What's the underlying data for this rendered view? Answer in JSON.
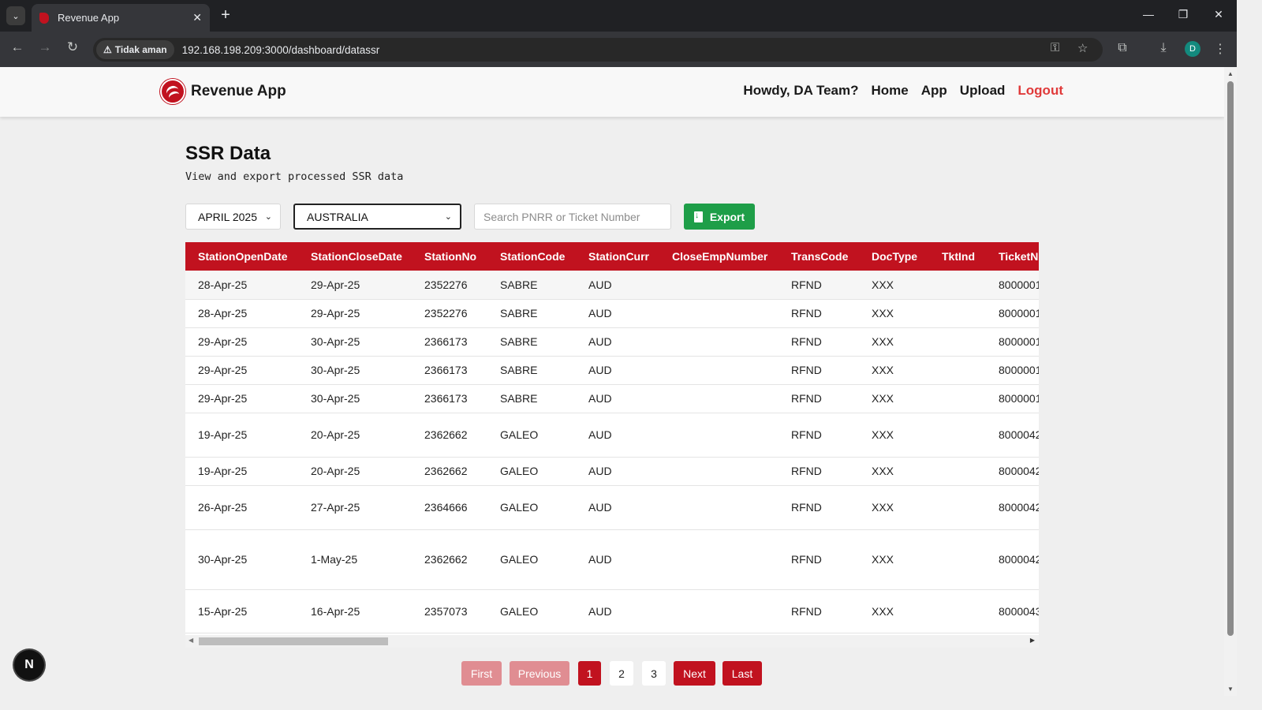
{
  "browser": {
    "tab_title": "Revenue App",
    "security_label": "Tidak aman",
    "url": "192.168.198.209:3000/dashboard/datassr",
    "profile_initial": "D"
  },
  "nav": {
    "brand": "Revenue App",
    "greeting": "Howdy, DA Team?",
    "links": [
      "Home",
      "App",
      "Upload"
    ],
    "logout": "Logout"
  },
  "page": {
    "title": "SSR Data",
    "subtitle": "View and export processed SSR data"
  },
  "filters": {
    "month_value": "APRIL 2025",
    "country_value": "AUSTRALIA",
    "search_placeholder": "Search PNRR or Ticket Number",
    "export_label": "Export"
  },
  "table": {
    "columns": [
      "StationOpenDate",
      "StationCloseDate",
      "StationNo",
      "StationCode",
      "StationCurr",
      "CloseEmpNumber",
      "TransCode",
      "DocType",
      "TktInd",
      "TicketNumber"
    ],
    "rows": [
      [
        "28-Apr-25",
        "29-Apr-25",
        "2352276",
        "SABRE",
        "AUD",
        "",
        "RFND",
        "XXX",
        "",
        "8000001"
      ],
      [
        "28-Apr-25",
        "29-Apr-25",
        "2352276",
        "SABRE",
        "AUD",
        "",
        "RFND",
        "XXX",
        "",
        "8000001"
      ],
      [
        "29-Apr-25",
        "30-Apr-25",
        "2366173",
        "SABRE",
        "AUD",
        "",
        "RFND",
        "XXX",
        "",
        "8000001"
      ],
      [
        "29-Apr-25",
        "30-Apr-25",
        "2366173",
        "SABRE",
        "AUD",
        "",
        "RFND",
        "XXX",
        "",
        "8000001"
      ],
      [
        "29-Apr-25",
        "30-Apr-25",
        "2366173",
        "SABRE",
        "AUD",
        "",
        "RFND",
        "XXX",
        "",
        "8000001"
      ],
      [
        "19-Apr-25",
        "20-Apr-25",
        "2362662",
        "GALEO",
        "AUD",
        "",
        "RFND",
        "XXX",
        "",
        "8000042"
      ],
      [
        "19-Apr-25",
        "20-Apr-25",
        "2362662",
        "GALEO",
        "AUD",
        "",
        "RFND",
        "XXX",
        "",
        "8000042"
      ],
      [
        "26-Apr-25",
        "27-Apr-25",
        "2364666",
        "GALEO",
        "AUD",
        "",
        "RFND",
        "XXX",
        "",
        "8000042"
      ],
      [
        "30-Apr-25",
        "1-May-25",
        "2362662",
        "GALEO",
        "AUD",
        "",
        "RFND",
        "XXX",
        "",
        "8000042"
      ],
      [
        "15-Apr-25",
        "16-Apr-25",
        "2357073",
        "GALEO",
        "AUD",
        "",
        "RFND",
        "XXX",
        "",
        "8000043"
      ]
    ]
  },
  "pagination": {
    "first": "First",
    "previous": "Previous",
    "pages": [
      "1",
      "2",
      "3"
    ],
    "current_page": "1",
    "next": "Next",
    "last": "Last"
  },
  "dev_badge": "N",
  "colors": {
    "brand_red": "#c1121f",
    "export_green": "#1e9e48",
    "logout_red": "#e03a3a"
  }
}
